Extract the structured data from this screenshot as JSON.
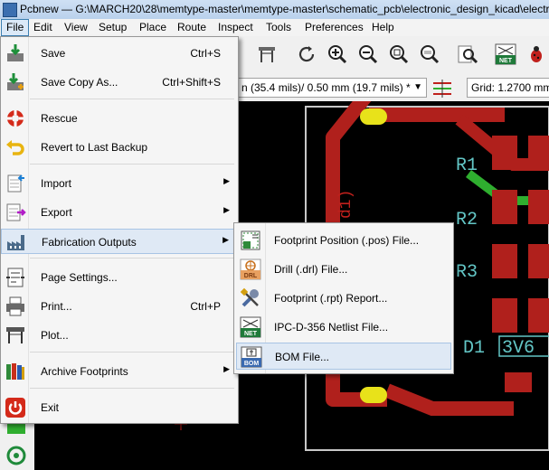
{
  "window": {
    "title": "Pcbnew — G:\\MARCH20\\28\\memtype-master\\memtype-master\\schematic_pcb\\electronic_design_kicad\\electr"
  },
  "menubar": {
    "items": [
      "File",
      "Edit",
      "View",
      "Setup",
      "Place",
      "Route",
      "Inspect",
      "Tools",
      "Preferences",
      "Help"
    ]
  },
  "auxbar": {
    "track_width": "n (35.4 mils)/ 0.50 mm (19.7 mils) *",
    "grid": "Grid: 1.2700 mm"
  },
  "file_menu": {
    "items": [
      {
        "label": "Save",
        "shortcut": "Ctrl+S"
      },
      {
        "label": "Save Copy As...",
        "shortcut": "Ctrl+Shift+S"
      },
      {
        "label": "Rescue",
        "shortcut": ""
      },
      {
        "label": "Revert to Last Backup",
        "shortcut": ""
      },
      {
        "label": "Import",
        "shortcut": ""
      },
      {
        "label": "Export",
        "shortcut": ""
      },
      {
        "label": "Fabrication Outputs",
        "shortcut": ""
      },
      {
        "label": "Page Settings...",
        "shortcut": ""
      },
      {
        "label": "Print...",
        "shortcut": "Ctrl+P"
      },
      {
        "label": "Plot...",
        "shortcut": ""
      },
      {
        "label": "Archive Footprints",
        "shortcut": ""
      },
      {
        "label": "Exit",
        "shortcut": ""
      }
    ],
    "submenu_arrow": "▶"
  },
  "fabrication_submenu": {
    "items": [
      {
        "label": "Footprint Position (.pos) File..."
      },
      {
        "label": "Drill (.drl) File..."
      },
      {
        "label": "Footprint (.rpt) Report..."
      },
      {
        "label": "IPC-D-356 Netlist File..."
      },
      {
        "label": "BOM File..."
      }
    ],
    "highlighted": "BOM File..."
  },
  "canvas": {
    "labels": {
      "r1": "R1",
      "r2": "R2",
      "r3": "R3",
      "d1": "D1",
      "d1_vertical": "d1)",
      "value_3v6": "3V6"
    },
    "colors": {
      "background": "#000000",
      "track": "#b0201c",
      "pad_yellow": "#e8e21a",
      "green": "#2fae2f",
      "edge": "#c8c8c8",
      "label": "#63c6c6"
    }
  },
  "icon_text": {
    "drl": "DRL",
    "net": "NET",
    "bom": "BOM"
  },
  "colors": {
    "accent": "#3c7fb1",
    "highlight": "#dfe9f5"
  }
}
